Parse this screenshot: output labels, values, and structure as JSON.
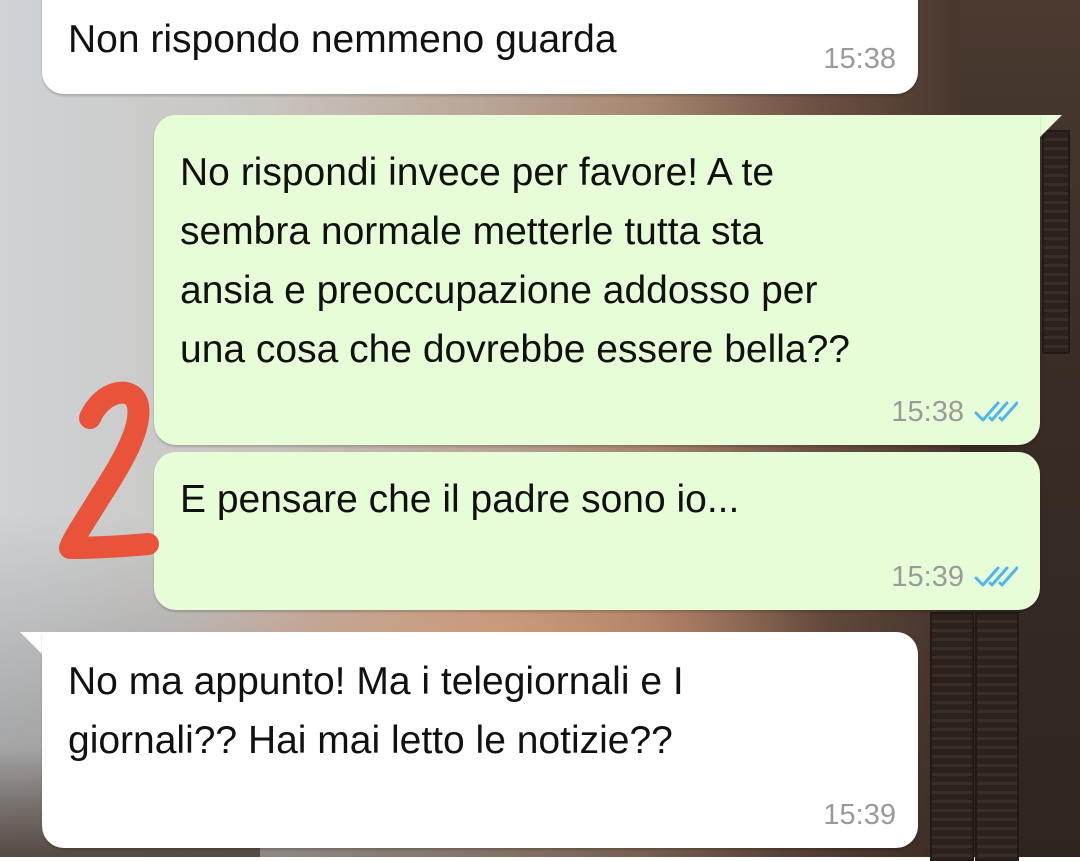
{
  "messages": [
    {
      "direction": "incoming",
      "text": "Non rispondo nemmeno guarda",
      "time": "15:38"
    },
    {
      "direction": "outgoing",
      "text": "No rispondi invece per favore! A te\nsembra normale metterle tutta sta\nansia e preoccupazione addosso per\nuna cosa che dovrebbe essere bella??",
      "time": "15:38",
      "status": "read"
    },
    {
      "direction": "outgoing",
      "text": "E pensare che il padre sono io...",
      "time": "15:39",
      "status": "read"
    },
    {
      "direction": "incoming",
      "text": "No ma appunto! Ma i telegiornali e I\ngiornali?? Hai mai letto le notizie??",
      "time": "15:39"
    }
  ],
  "annotation": {
    "text": "2",
    "color": "#e8533a"
  },
  "colors": {
    "incoming_bubble": "#ffffff",
    "outgoing_bubble": "#e7fdd8",
    "read_ticks": "#4fb6ec",
    "timestamp": "#9a9a9a"
  }
}
